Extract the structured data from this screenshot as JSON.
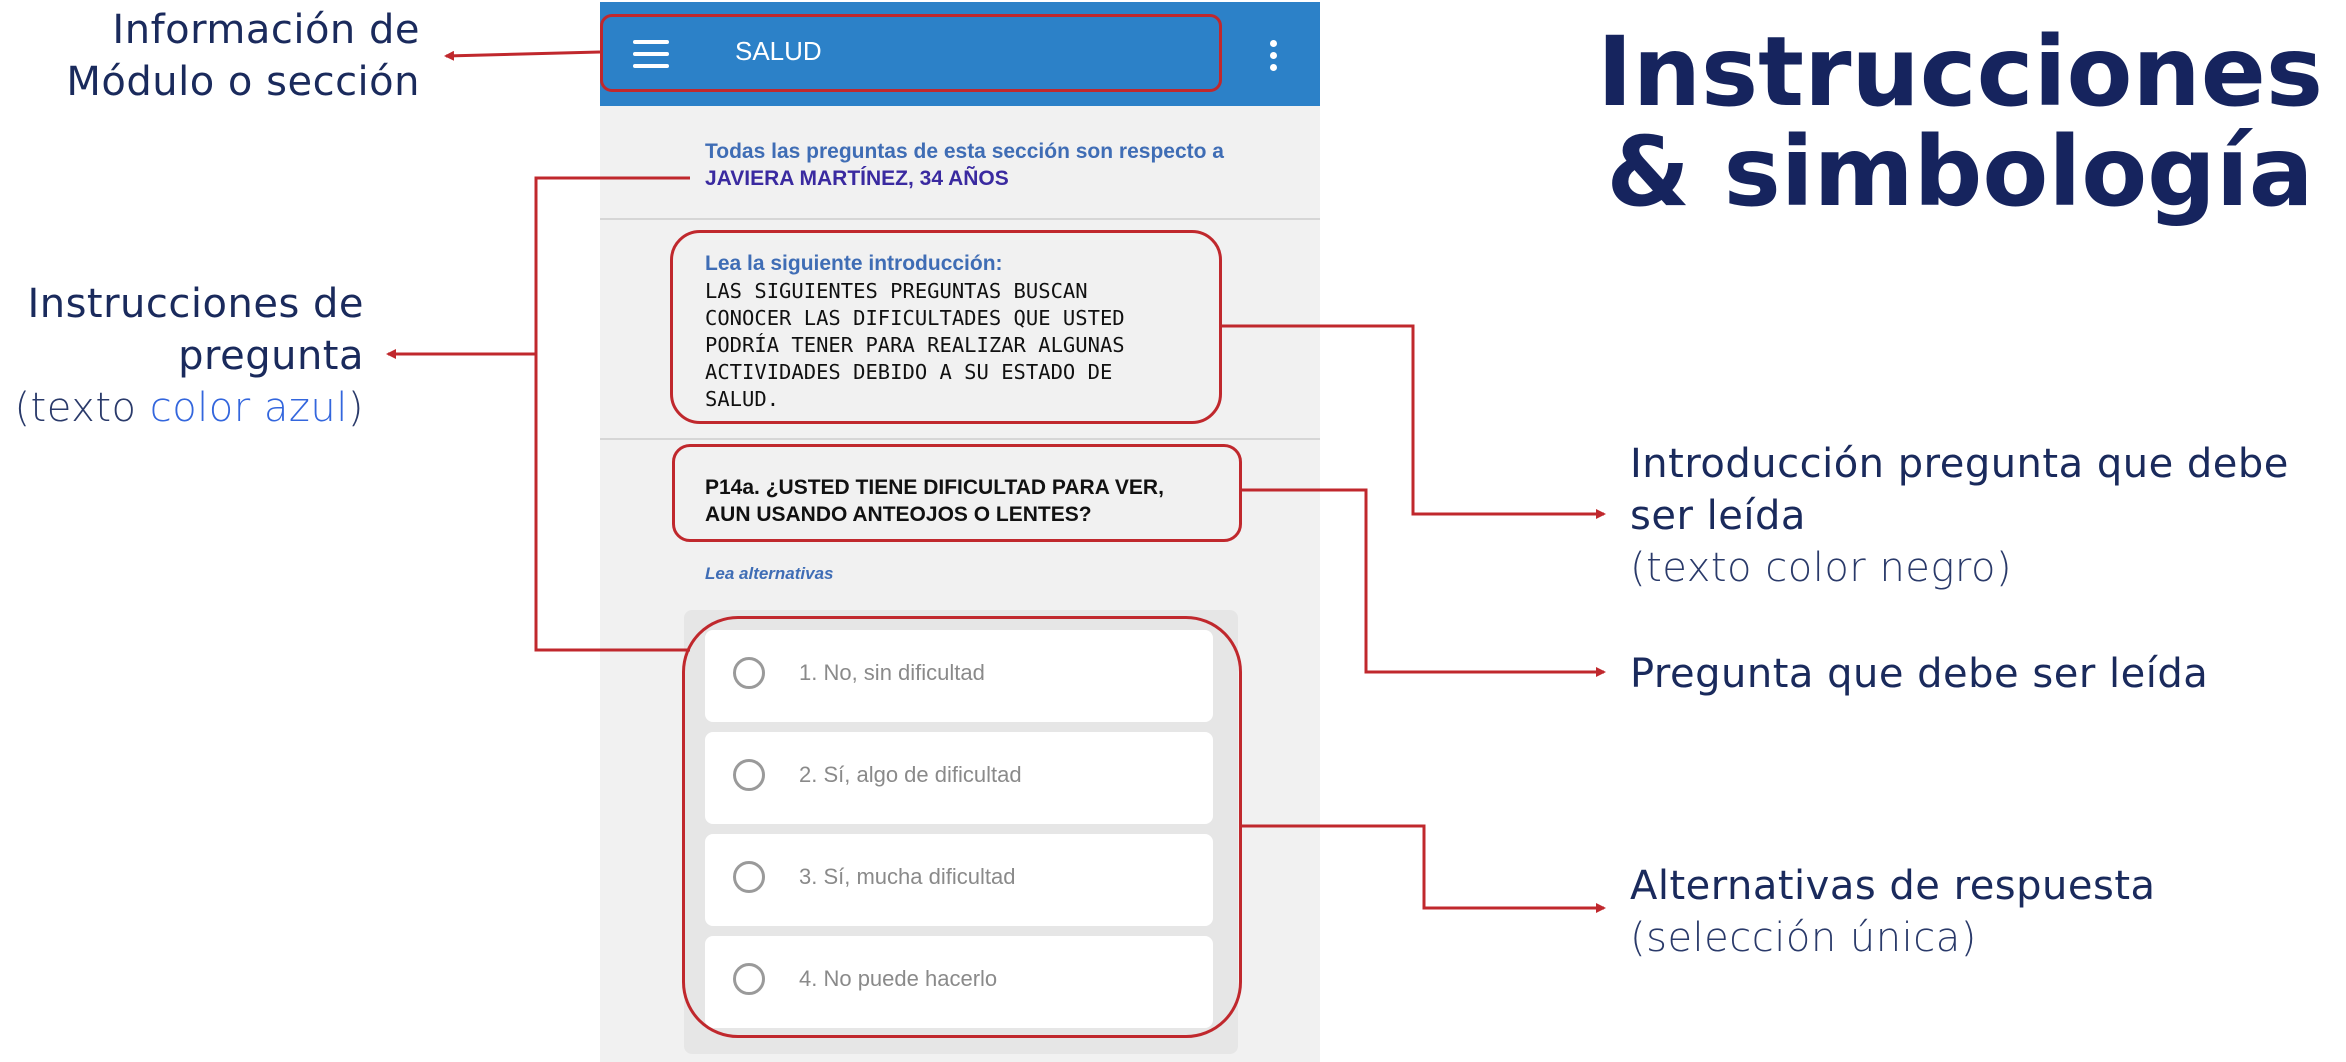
{
  "title": {
    "line1": "Instrucciones",
    "line2": "& simbología"
  },
  "annotations": {
    "module": {
      "line1": "Información de",
      "line2": "Módulo o sección"
    },
    "instructions": {
      "line1": "Instrucciones de",
      "line2": "pregunta",
      "note_open": "(texto ",
      "note_color_word": "color azul",
      "note_close": ")"
    },
    "intro": {
      "line1": "Introducción pregunta que debe",
      "line2": "ser leída",
      "note_open": "(texto",
      "note_rest": " color negro)"
    },
    "question": {
      "label": "Pregunta que debe ser leída"
    },
    "alternatives": {
      "label": "Alternativas de respuesta",
      "note": "(selección única)"
    }
  },
  "app": {
    "header": {
      "title": "SALUD",
      "menu_icon": "hamburger-menu-icon",
      "more_icon": "kebab-more-icon"
    },
    "section_note": {
      "prefix": "Todas las preguntas de esta sección son respecto a ",
      "respondent": "JAVIERA MARTÍNEZ, 34 AÑOS"
    },
    "intro": {
      "label": "Lea la siguiente introducción:",
      "lines": [
        "LAS SIGUIENTES PREGUNTAS BUSCAN",
        "CONOCER LAS DIFICULTADES QUE USTED",
        "PODRÍA TENER PARA REALIZAR ALGUNAS",
        "ACTIVIDADES DEBIDO A SU ESTADO DE",
        "SALUD."
      ]
    },
    "question": {
      "line1": "P14a. ¿USTED TIENE DIFICULTAD PARA VER,",
      "line2": "AUN USANDO ANTEOJOS O LENTES?"
    },
    "alternatives_hint": "Lea alternativas",
    "options": [
      "1. No, sin dificultad",
      "2. Sí, algo de dificultad",
      "3. Sí, mucha dificultad",
      "4. No puede hacerlo"
    ]
  },
  "colors": {
    "annotation_red": "#c0282d",
    "title_navy": "#16245e",
    "appbar_blue": "#2c81c8",
    "instruction_blue": "#3f6db5"
  }
}
